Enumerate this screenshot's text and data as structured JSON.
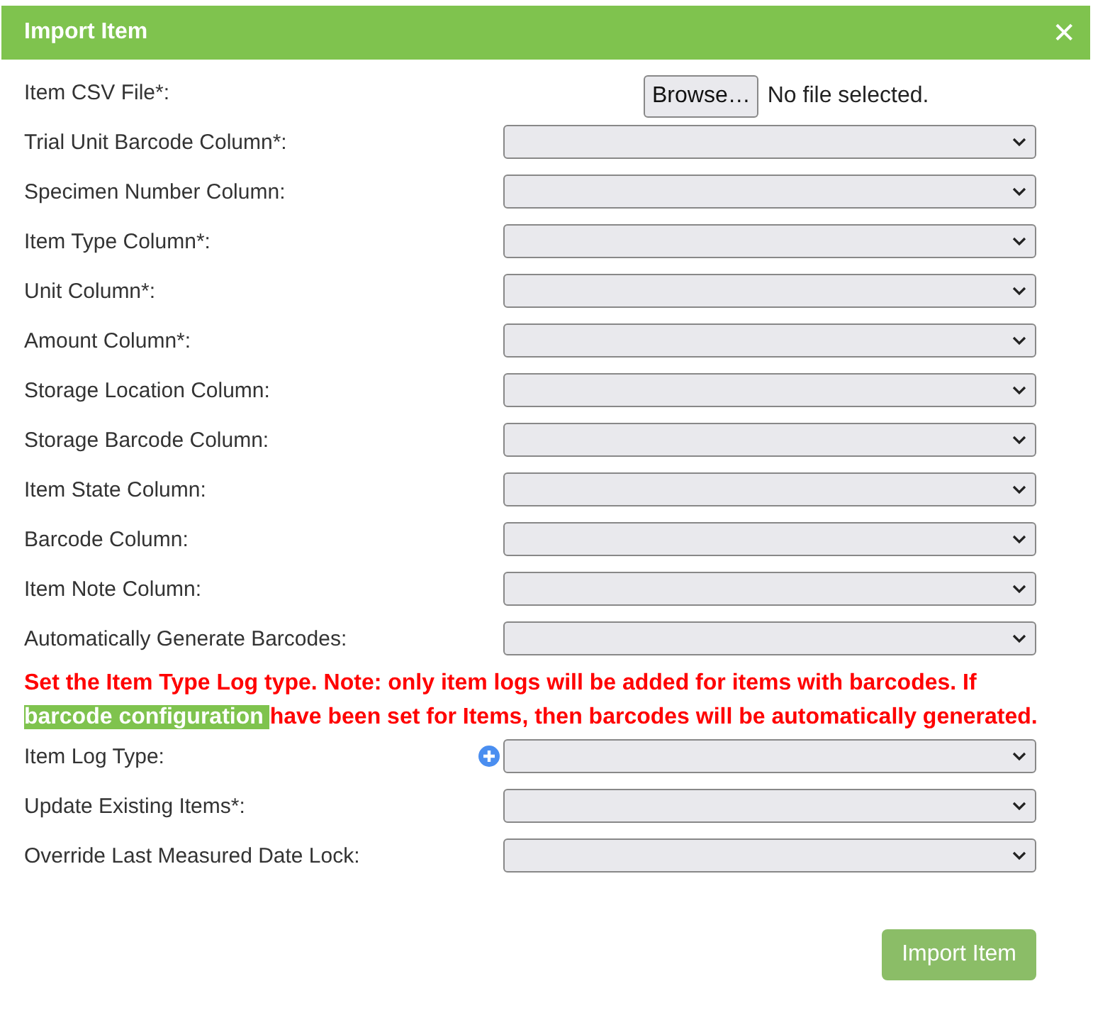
{
  "dialog": {
    "title": "Import Item",
    "close": "✕"
  },
  "rows": [
    {
      "kind": "file",
      "label": "Item CSV File*:",
      "button": "Browse…",
      "status": "No file selected."
    },
    {
      "kind": "select",
      "label": "Trial Unit Barcode Column*:"
    },
    {
      "kind": "select",
      "label": "Specimen Number Column:"
    },
    {
      "kind": "select",
      "label": "Item Type Column*:"
    },
    {
      "kind": "select",
      "label": "Unit Column*:"
    },
    {
      "kind": "select",
      "label": "Amount Column*:"
    },
    {
      "kind": "select",
      "label": "Storage Location Column:"
    },
    {
      "kind": "select",
      "label": "Storage Barcode Column:"
    },
    {
      "kind": "select",
      "label": "Item State Column:"
    },
    {
      "kind": "select",
      "label": "Barcode Column:"
    },
    {
      "kind": "select",
      "label": "Item Note Column:"
    },
    {
      "kind": "select",
      "label": "Automatically Generate Barcodes:"
    },
    {
      "kind": "note",
      "before": "Set the Item Type Log type. Note: only item logs will be added for items with barcodes. If ",
      "highlight": "barcode configuration ",
      "after": "have been set for Items, then barcodes will be automatically generated."
    },
    {
      "kind": "select",
      "label": "Item Log Type:",
      "add": true
    },
    {
      "kind": "select",
      "label": "Update Existing Items*:"
    },
    {
      "kind": "select",
      "label": "Override Last Measured Date Lock:"
    }
  ],
  "submit": "Import Item"
}
